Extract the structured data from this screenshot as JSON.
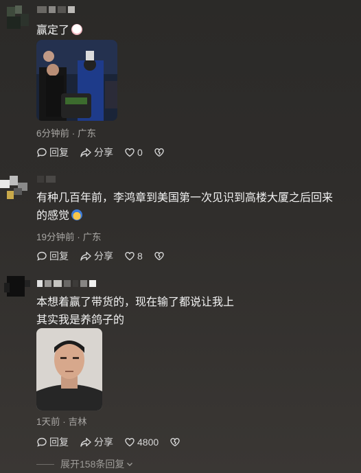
{
  "comments": [
    {
      "text_lines": [
        "赢定了"
      ],
      "emoji": "cat-face-emoji",
      "time": "6分钟前",
      "location": "广东",
      "reply_label": "回复",
      "share_label": "分享",
      "likes": "0"
    },
    {
      "text_lines": [
        "有种几百年前，李鸿章到美国第一次见识到高楼大厦之后回来",
        "的感觉"
      ],
      "emoji": "shocked-face-emoji",
      "time": "19分钟前",
      "location": "广东",
      "reply_label": "回复",
      "share_label": "分享",
      "likes": "8"
    },
    {
      "text_lines": [
        "本想着赢了带货的，现在输了都说让我上",
        "其实我是养鸽子的"
      ],
      "time": "1天前",
      "location": "吉林",
      "reply_label": "回复",
      "share_label": "分享",
      "likes": "4800"
    }
  ],
  "meta_separator": "·",
  "expand_replies": "展开158条回复",
  "colors": {
    "background": "#2f2d2b",
    "text": "#f2f2f2",
    "meta": "#a9a7a4"
  }
}
